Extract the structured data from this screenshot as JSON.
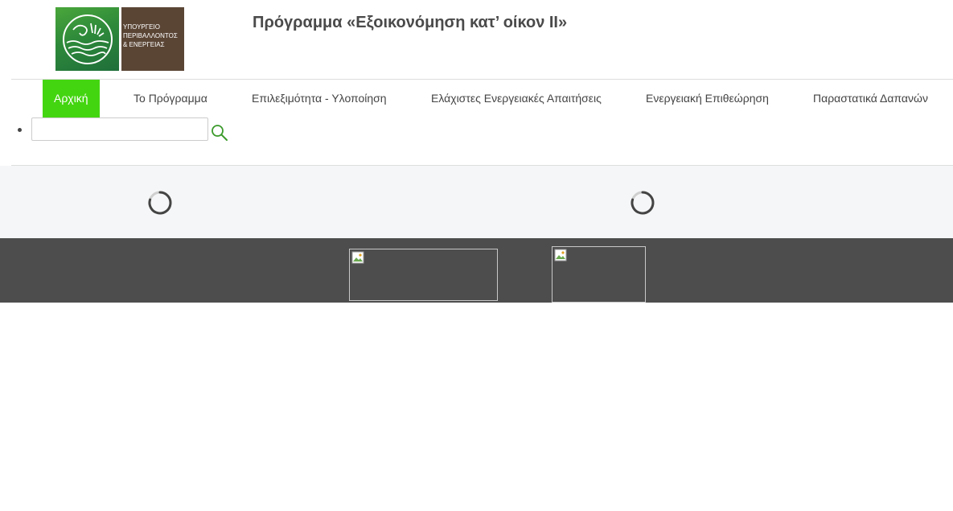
{
  "header": {
    "logo": {
      "text_lines": [
        "ΥΠΟΥΡΓΕΙΟ",
        "ΠΕΡΙΒΑΛΛΟΝΤΟΣ",
        "& ΕΝΕΡΓΕΙΑΣ"
      ]
    },
    "title": "Πρόγραμμα «Εξοικονόμηση κατ’ οίκον ΙΙ»"
  },
  "nav": {
    "items": [
      {
        "label": "Αρχική",
        "active": true
      },
      {
        "label": "Το Πρόγραμμα",
        "active": false
      },
      {
        "label": "Επιλεξιμότητα - Υλοποίηση",
        "active": false
      },
      {
        "label": "Ελάχιστες Ενεργειακές Απαιτήσεις",
        "active": false
      },
      {
        "label": "Ενεργειακή Επιθεώρηση",
        "active": false
      },
      {
        "label": "Παραστατικά Δαπανών",
        "active": false
      }
    ],
    "search": {
      "value": "",
      "placeholder": ""
    }
  },
  "colors": {
    "accent_active": "#44d511",
    "logo_green": "#2e8a3a",
    "logo_brown": "#5a4535",
    "loader_band_bg": "#f5f6f7",
    "footer_bg": "#4d4d4d",
    "search_icon": "#3a9a2a"
  },
  "icons": {
    "search": "search-icon",
    "loading": "loading-spinner-icon",
    "broken_image": "broken-image-icon"
  }
}
